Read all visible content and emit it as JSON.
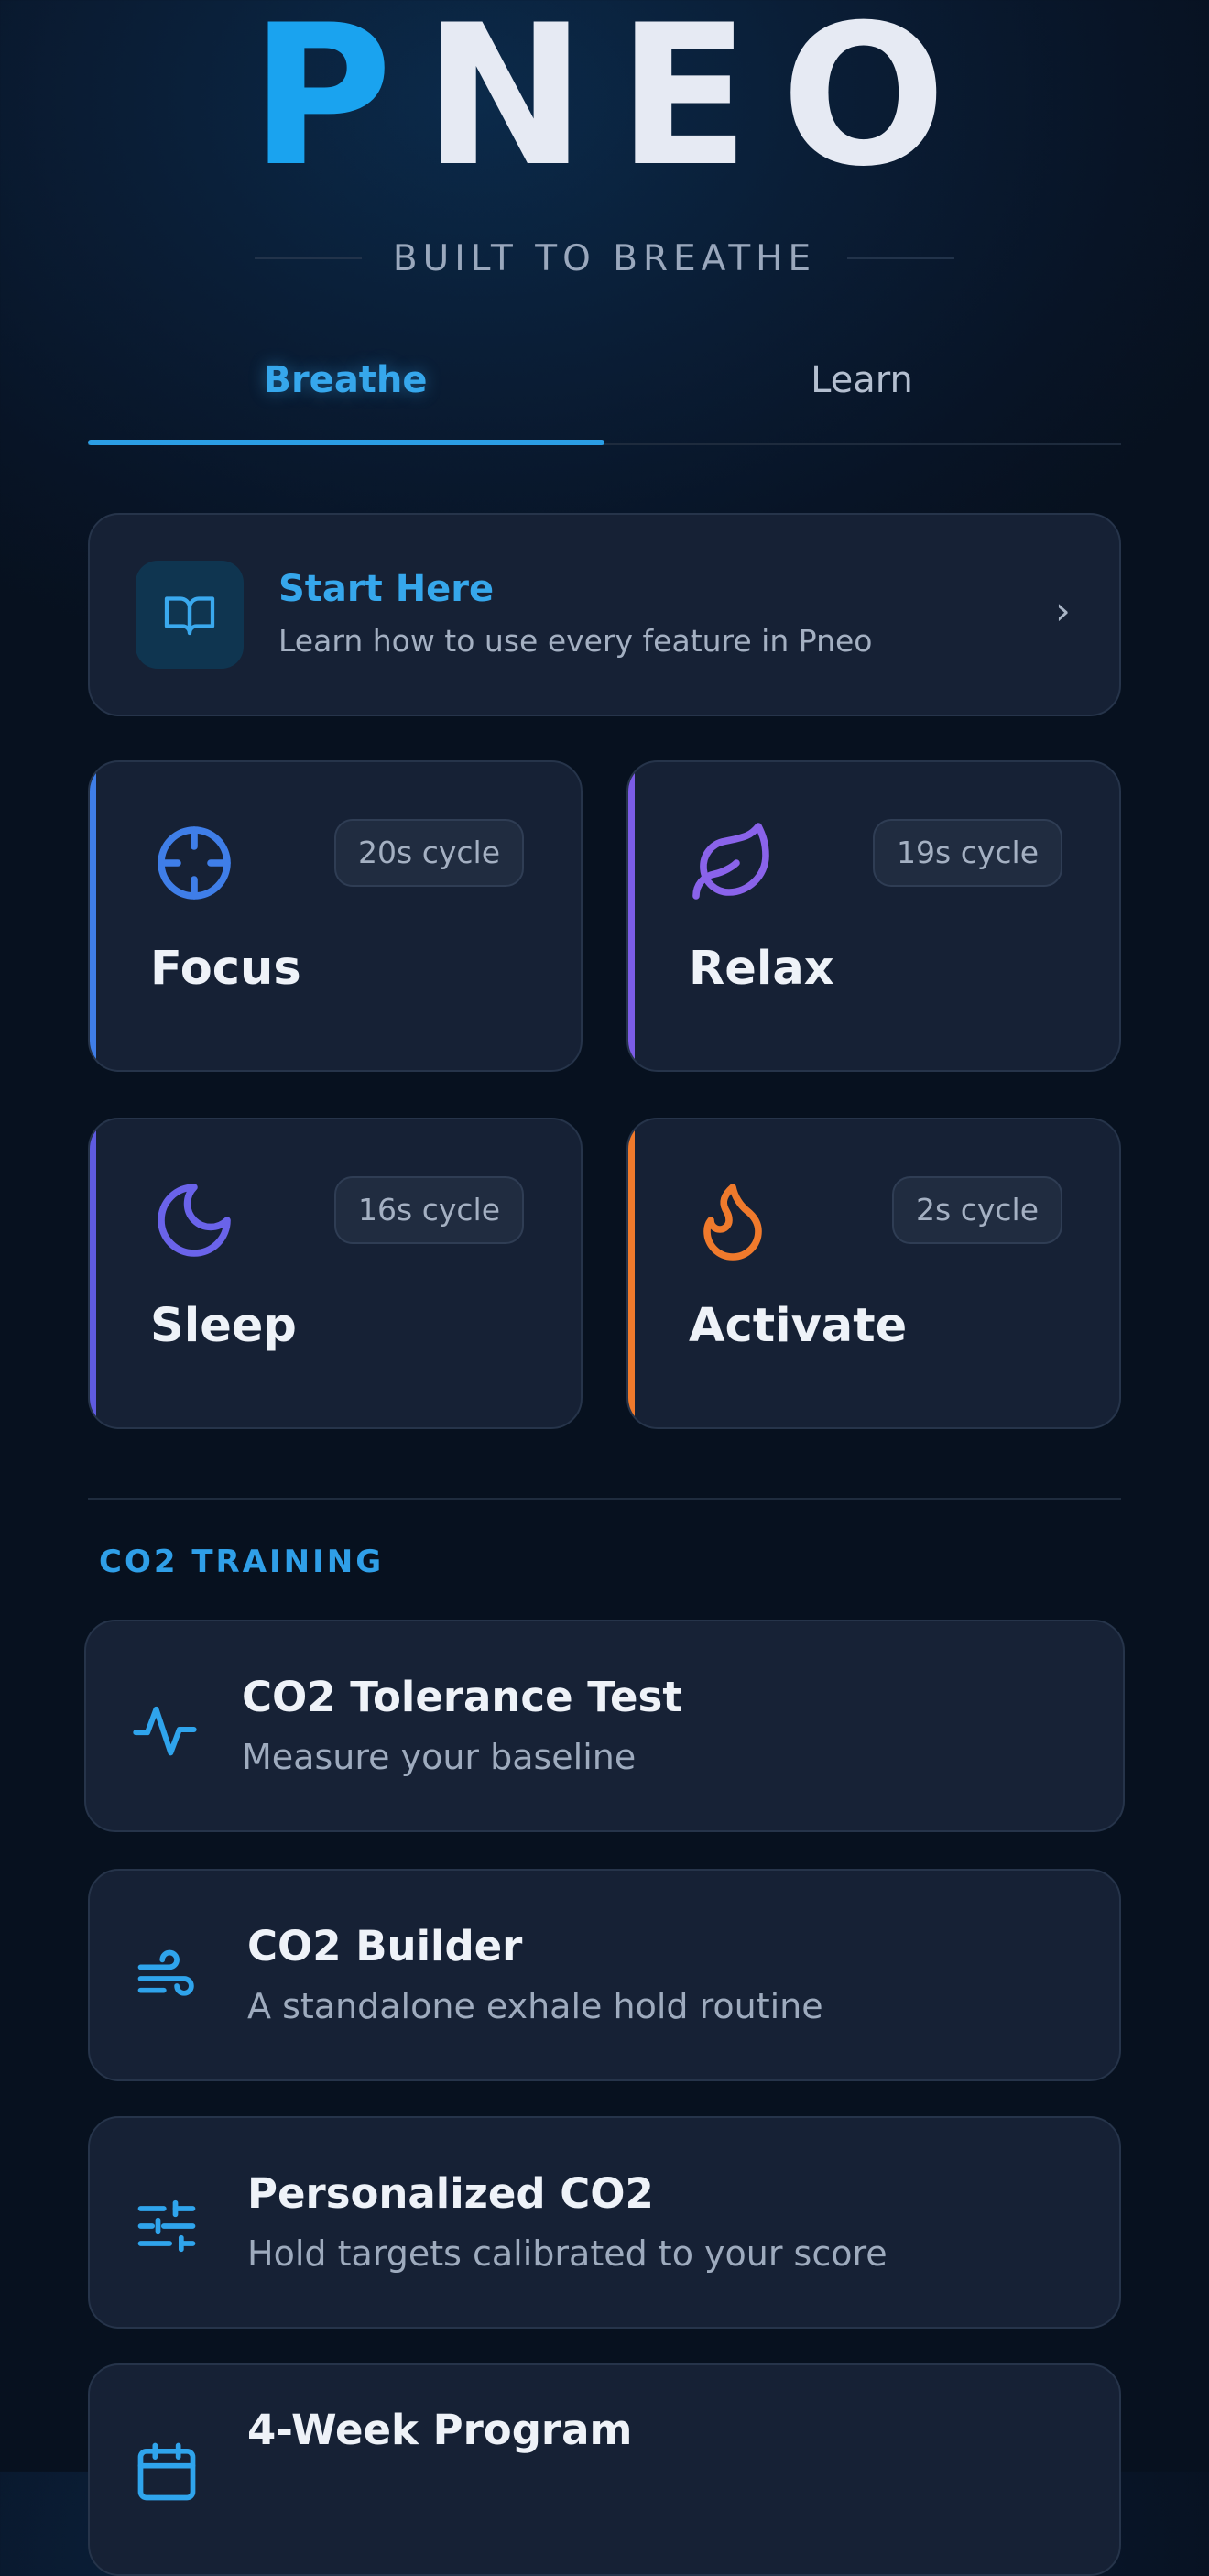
{
  "app": {
    "logo_first": "P",
    "logo_rest": "NEO",
    "tagline": "BUILT TO BREATHE"
  },
  "tabs": [
    {
      "label": "Breathe",
      "active": true
    },
    {
      "label": "Learn",
      "active": false
    }
  ],
  "start_here": {
    "title": "Start Here",
    "subtitle": "Learn how to use every feature in Pneo",
    "icon": "book-open-icon"
  },
  "modes": [
    {
      "label": "Focus",
      "badge": "20s cycle",
      "icon": "crosshair-icon",
      "color": "#3f7ee8"
    },
    {
      "label": "Relax",
      "badge": "19s cycle",
      "icon": "leaf-icon",
      "color": "#7b5ce6"
    },
    {
      "label": "Sleep",
      "badge": "16s cycle",
      "icon": "moon-icon",
      "color": "#5f5be0"
    },
    {
      "label": "Activate",
      "badge": "2s cycle",
      "icon": "flame-icon",
      "color": "#f07a2c"
    }
  ],
  "co2_section": {
    "heading": "CO2 TRAINING",
    "items": [
      {
        "title": "CO2 Tolerance Test",
        "subtitle": "Measure your baseline",
        "icon": "pulse-icon"
      },
      {
        "title": "CO2 Builder",
        "subtitle": "A standalone exhale hold routine",
        "icon": "wind-icon"
      },
      {
        "title": "Personalized CO2",
        "subtitle": "Hold targets calibrated to your score",
        "icon": "sliders-icon"
      },
      {
        "title": "4-Week Program",
        "subtitle": "",
        "icon": "calendar-icon"
      }
    ]
  },
  "colors": {
    "accent": "#2f9fe8",
    "background": "#081426",
    "card": "#162135"
  }
}
